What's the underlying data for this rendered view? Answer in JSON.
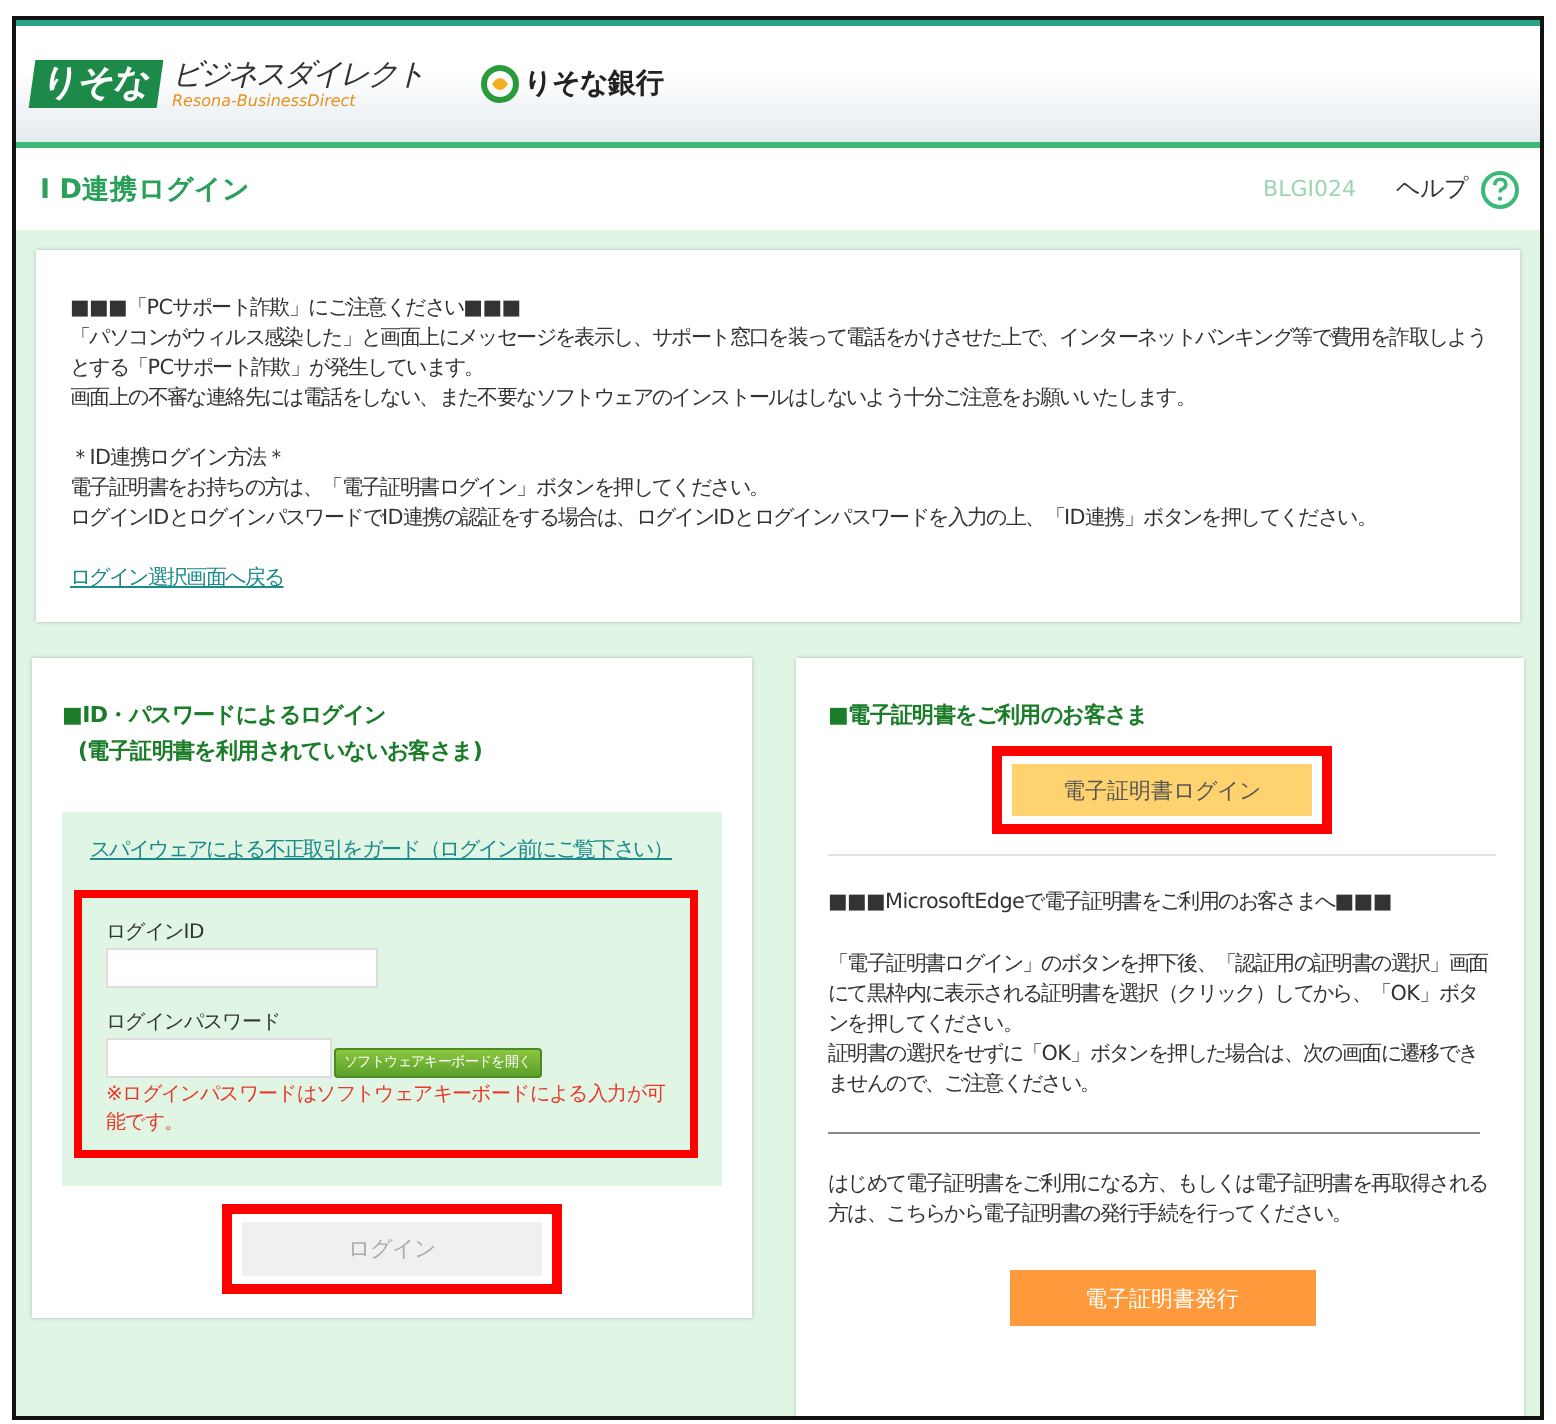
{
  "header": {
    "brand_mark": "りそな",
    "brand_name": "ビジネスダイレクト",
    "brand_sub": "Resona-BusinessDirect",
    "bank_name": "りそな銀行"
  },
  "page": {
    "title": "I D連携ログイン",
    "screen_id": "BLGI024",
    "help": "ヘルプ"
  },
  "notice": {
    "blocks": [
      [
        "■■■「PCサポート詐欺」にご注意ください■■■",
        "「パソコンがウィルス感染した」と画面上にメッセージを表示し、サポート窓口を装って電話をかけさせた上で、インターネットバンキング等で費用を詐取しようとする「PCサポート詐欺」が発生しています。",
        "画面上の不審な連絡先には電話をしない、また不要なソフトウェアのインストールはしないよう十分ご注意をお願いいたします。"
      ],
      [
        "＊ID連携ログイン方法＊",
        "電子証明書をお持ちの方は、「電子証明書ログイン」ボタンを押してください。",
        "ログインIDとログインパスワードでID連携の認証をする場合は、ログインIDとログインパスワードを入力の上、「ID連携」ボタンを押してください。"
      ]
    ],
    "link": "ログイン選択画面へ戻る"
  },
  "password_login": {
    "heading_lines": [
      "■ID・パスワードによるログイン",
      "(電子証明書を利用されていないお客さま)"
    ],
    "guard_link": "スパイウェアによる不正取引をガード（ログイン前にご覧下さい）",
    "credentials_highlighted": true,
    "fields": [
      {
        "label": "ログインID",
        "kind": "text"
      },
      {
        "label": "ログインパスワード",
        "kind": "password"
      }
    ],
    "keyboard_button": "ソフトウェアキーボードを開く",
    "note": "※ログインパスワードはソフトウェアキーボードによる入力が可能です。",
    "login_button": {
      "label": "ログイン",
      "disabled": true,
      "highlighted": true
    }
  },
  "certificate_login": {
    "heading": "■電子証明書をご利用のお客さま",
    "login_button": {
      "label": "電子証明書ログイン",
      "highlighted": true
    },
    "edge_heading": "■■■MicrosoftEdgeで電子証明書をご利用のお客さまへ■■■",
    "edge_lines": [
      "「電子証明書ログイン」のボタンを押下後、「認証用の証明書の選択」画面にて黒枠内に表示される証明書を選択（クリック）してから、「OK」ボタンを押してください。",
      "証明書の選択をせずに「OK」ボタンを押した場合は、次の画面に遷移できませんので、ご注意ください。"
    ],
    "issue_text": "はじめて電子証明書をご利用になる方、もしくは電子証明書を再取得される方は、こちらから電子証明書の発行手続を行ってください。",
    "issue_button": "電子証明書発行"
  }
}
